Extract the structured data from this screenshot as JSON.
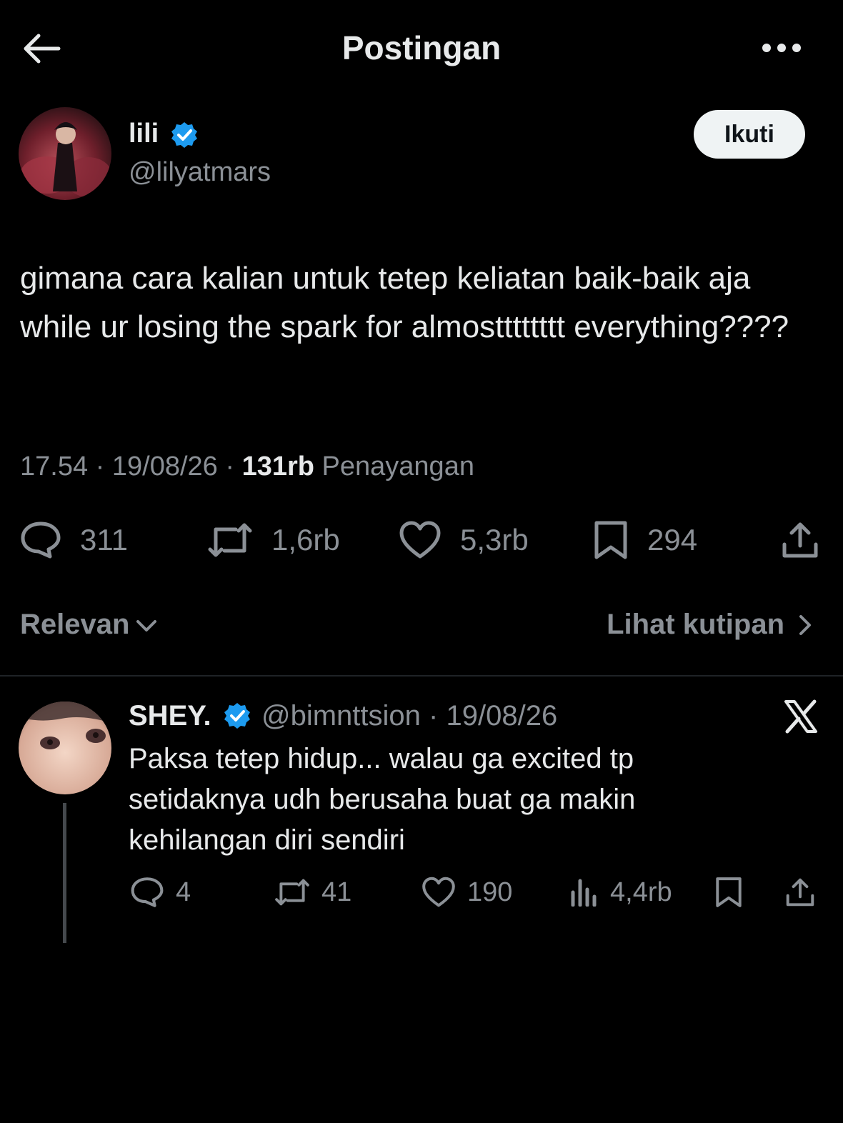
{
  "header": {
    "title": "Postingan",
    "back_icon": "arrow-left-icon",
    "more_icon": "more-horizontal-icon"
  },
  "post": {
    "author": {
      "name": "lili",
      "handle": "@lilyatmars",
      "verified": true
    },
    "follow_label": "Ikuti",
    "text": "gimana cara kalian untuk tetep keliatan baik-baik aja while ur losing the spark for almostttttttt everything????",
    "time": "17.54",
    "date": "19/08/26",
    "views_count": "131rb",
    "views_label": "Penayangan",
    "separator": "·",
    "stats": {
      "replies": "311",
      "reposts": "1,6rb",
      "likes": "5,3rb",
      "bookmarks": "294"
    }
  },
  "filters": {
    "sort_label": "Relevan",
    "quotes_label": "Lihat kutipan"
  },
  "reply": {
    "author": {
      "name": "SHEY.",
      "handle": "@bimnttsion",
      "verified": true
    },
    "date": "19/08/26",
    "text": "Paksa tetep hidup... walau ga excited tp setidaknya udh berusaha buat ga makin kehilangan diri sendiri",
    "stats": {
      "replies": "4",
      "reposts": "41",
      "likes": "190",
      "views": "4,4rb"
    }
  },
  "colors": {
    "background": "#000000",
    "text": "#e7e9ea",
    "secondary": "#8b9096",
    "verified": "#1d9bf0",
    "follow_bg": "#eff3f4"
  }
}
